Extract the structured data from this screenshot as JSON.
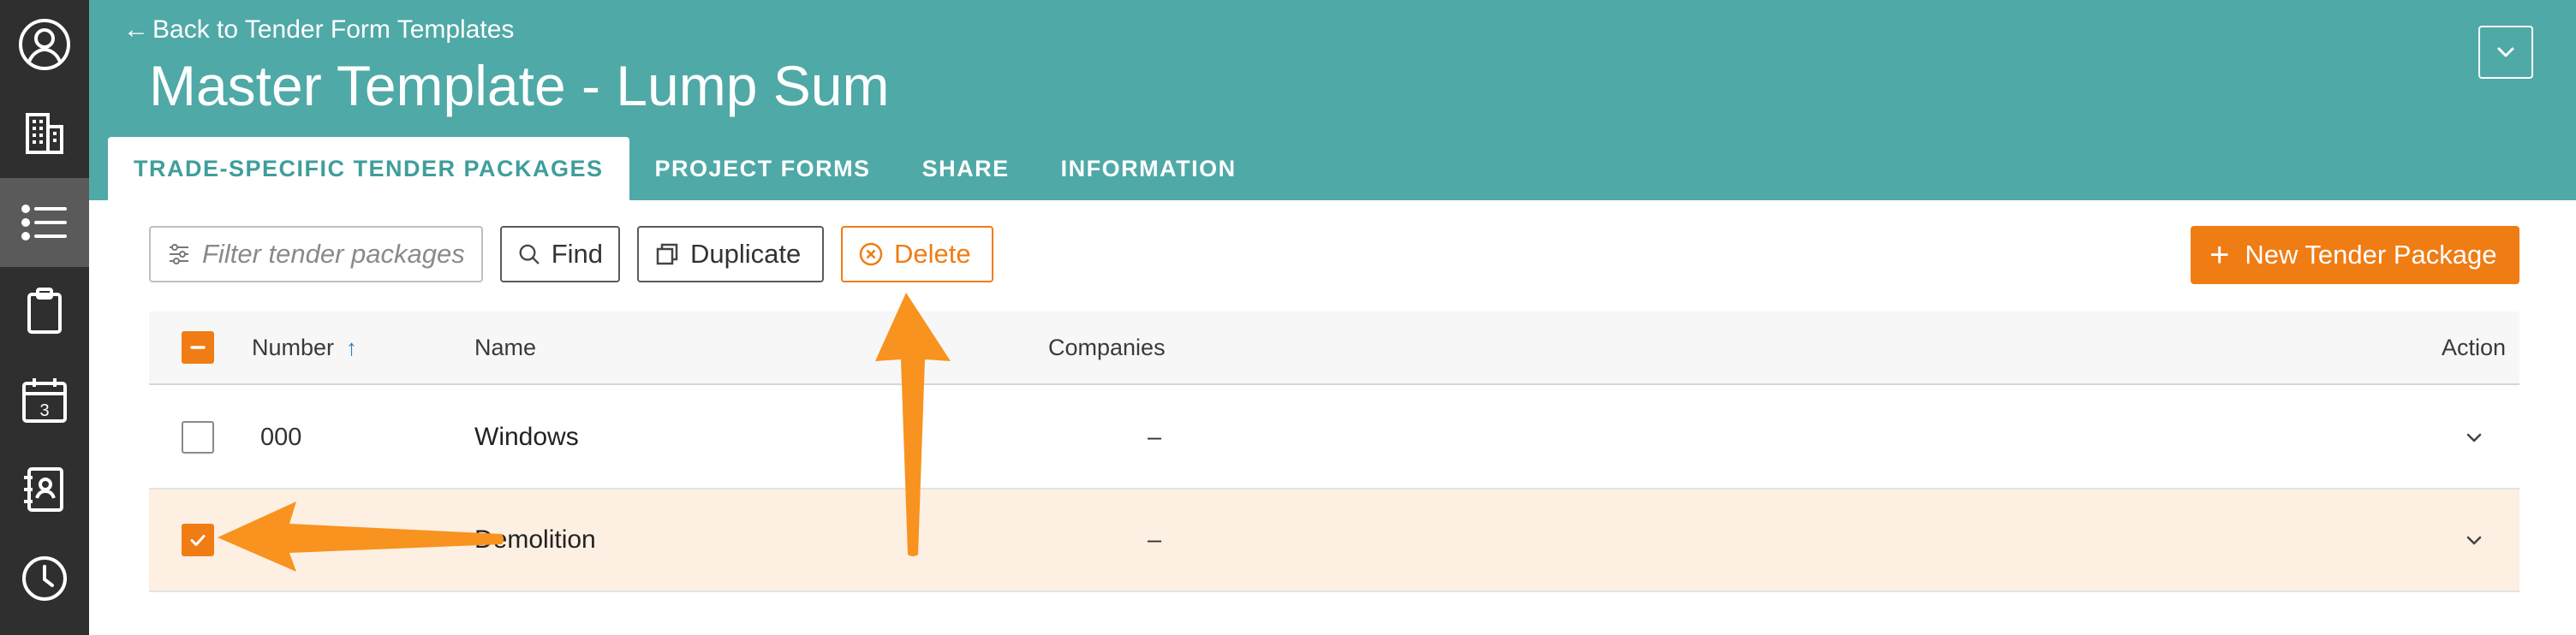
{
  "sidebar": {
    "items": [
      {
        "icon": "user-profile-icon"
      },
      {
        "icon": "building-icon"
      },
      {
        "icon": "list-icon",
        "active": true
      },
      {
        "icon": "clipboard-icon"
      },
      {
        "icon": "calendar-icon",
        "calendar_day": "3"
      },
      {
        "icon": "address-book-icon"
      },
      {
        "icon": "clock-icon"
      }
    ]
  },
  "header": {
    "back_link": "Back to Tender Form Templates",
    "back_arrow": "←",
    "title": "Master Template - Lump Sum",
    "tabs": [
      {
        "label": "TRADE-SPECIFIC TENDER PACKAGES",
        "active": true
      },
      {
        "label": "PROJECT FORMS"
      },
      {
        "label": "SHARE"
      },
      {
        "label": "INFORMATION"
      }
    ]
  },
  "toolbar": {
    "filter_placeholder": "Filter tender packages",
    "find_label": "Find",
    "duplicate_label": "Duplicate",
    "delete_label": "Delete",
    "new_label": "New Tender Package",
    "new_plus": "+"
  },
  "table": {
    "columns": {
      "number": "Number",
      "sort_arrow": "↑",
      "name": "Name",
      "companies": "Companies",
      "action": "Action"
    },
    "rows": [
      {
        "number": "000",
        "name": "Windows",
        "companies": "–",
        "checked": false
      },
      {
        "number": "",
        "name": "Demolition",
        "companies": "–",
        "checked": true
      }
    ]
  },
  "colors": {
    "header_teal": "#4fa9a7",
    "accent_orange": "#f07c14",
    "sidebar_dark": "#2f2f2f",
    "selected_row": "#fdefe2"
  }
}
